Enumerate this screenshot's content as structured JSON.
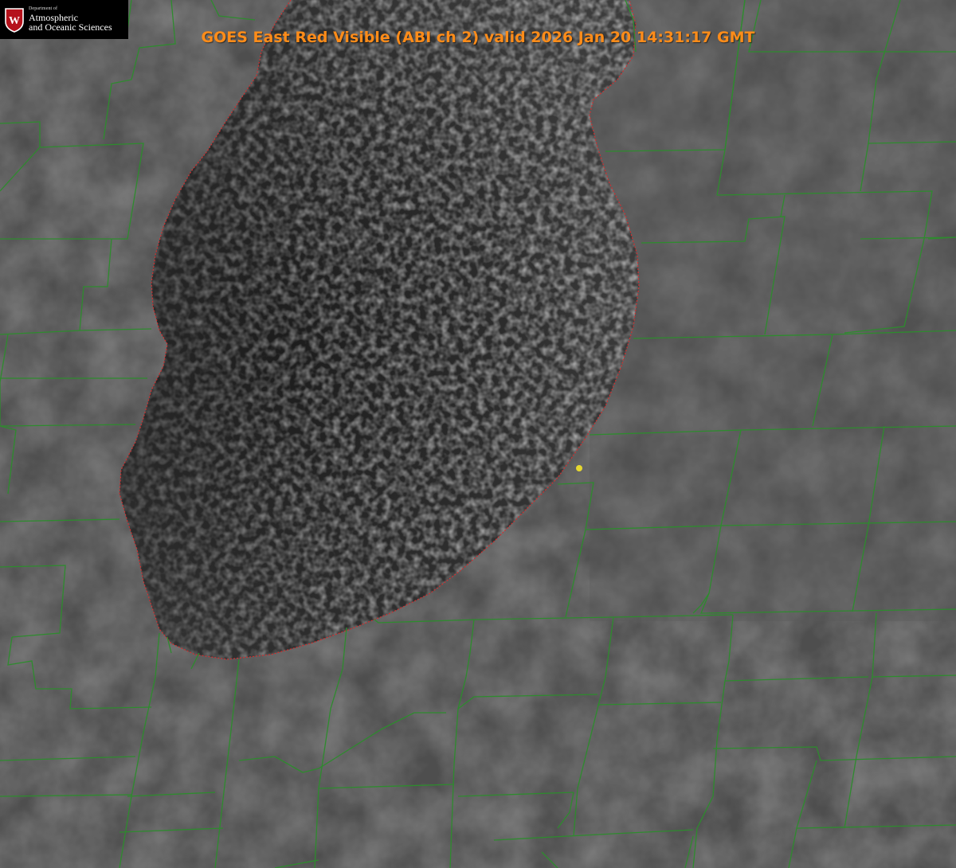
{
  "image": {
    "title": "GOES East Red Visible (ABI ch 2) valid 2026 Jan 20 14:31:17 GMT",
    "title_color": "#ff8c19",
    "boundary_color": "#2e8b2e",
    "shoreline_color": "#d03030",
    "marker_color": "#e6d830",
    "land_color": "#4e4e4e",
    "lake_color": "#262626"
  },
  "logo": {
    "department_of": "Department of",
    "line1": "Atmospheric",
    "line2": "and Oceanic Sciences",
    "crest_letter": "W",
    "crest_color": "#b5121b"
  },
  "icons": {
    "crest": "university-crest-icon",
    "marker": "location-marker-icon"
  }
}
